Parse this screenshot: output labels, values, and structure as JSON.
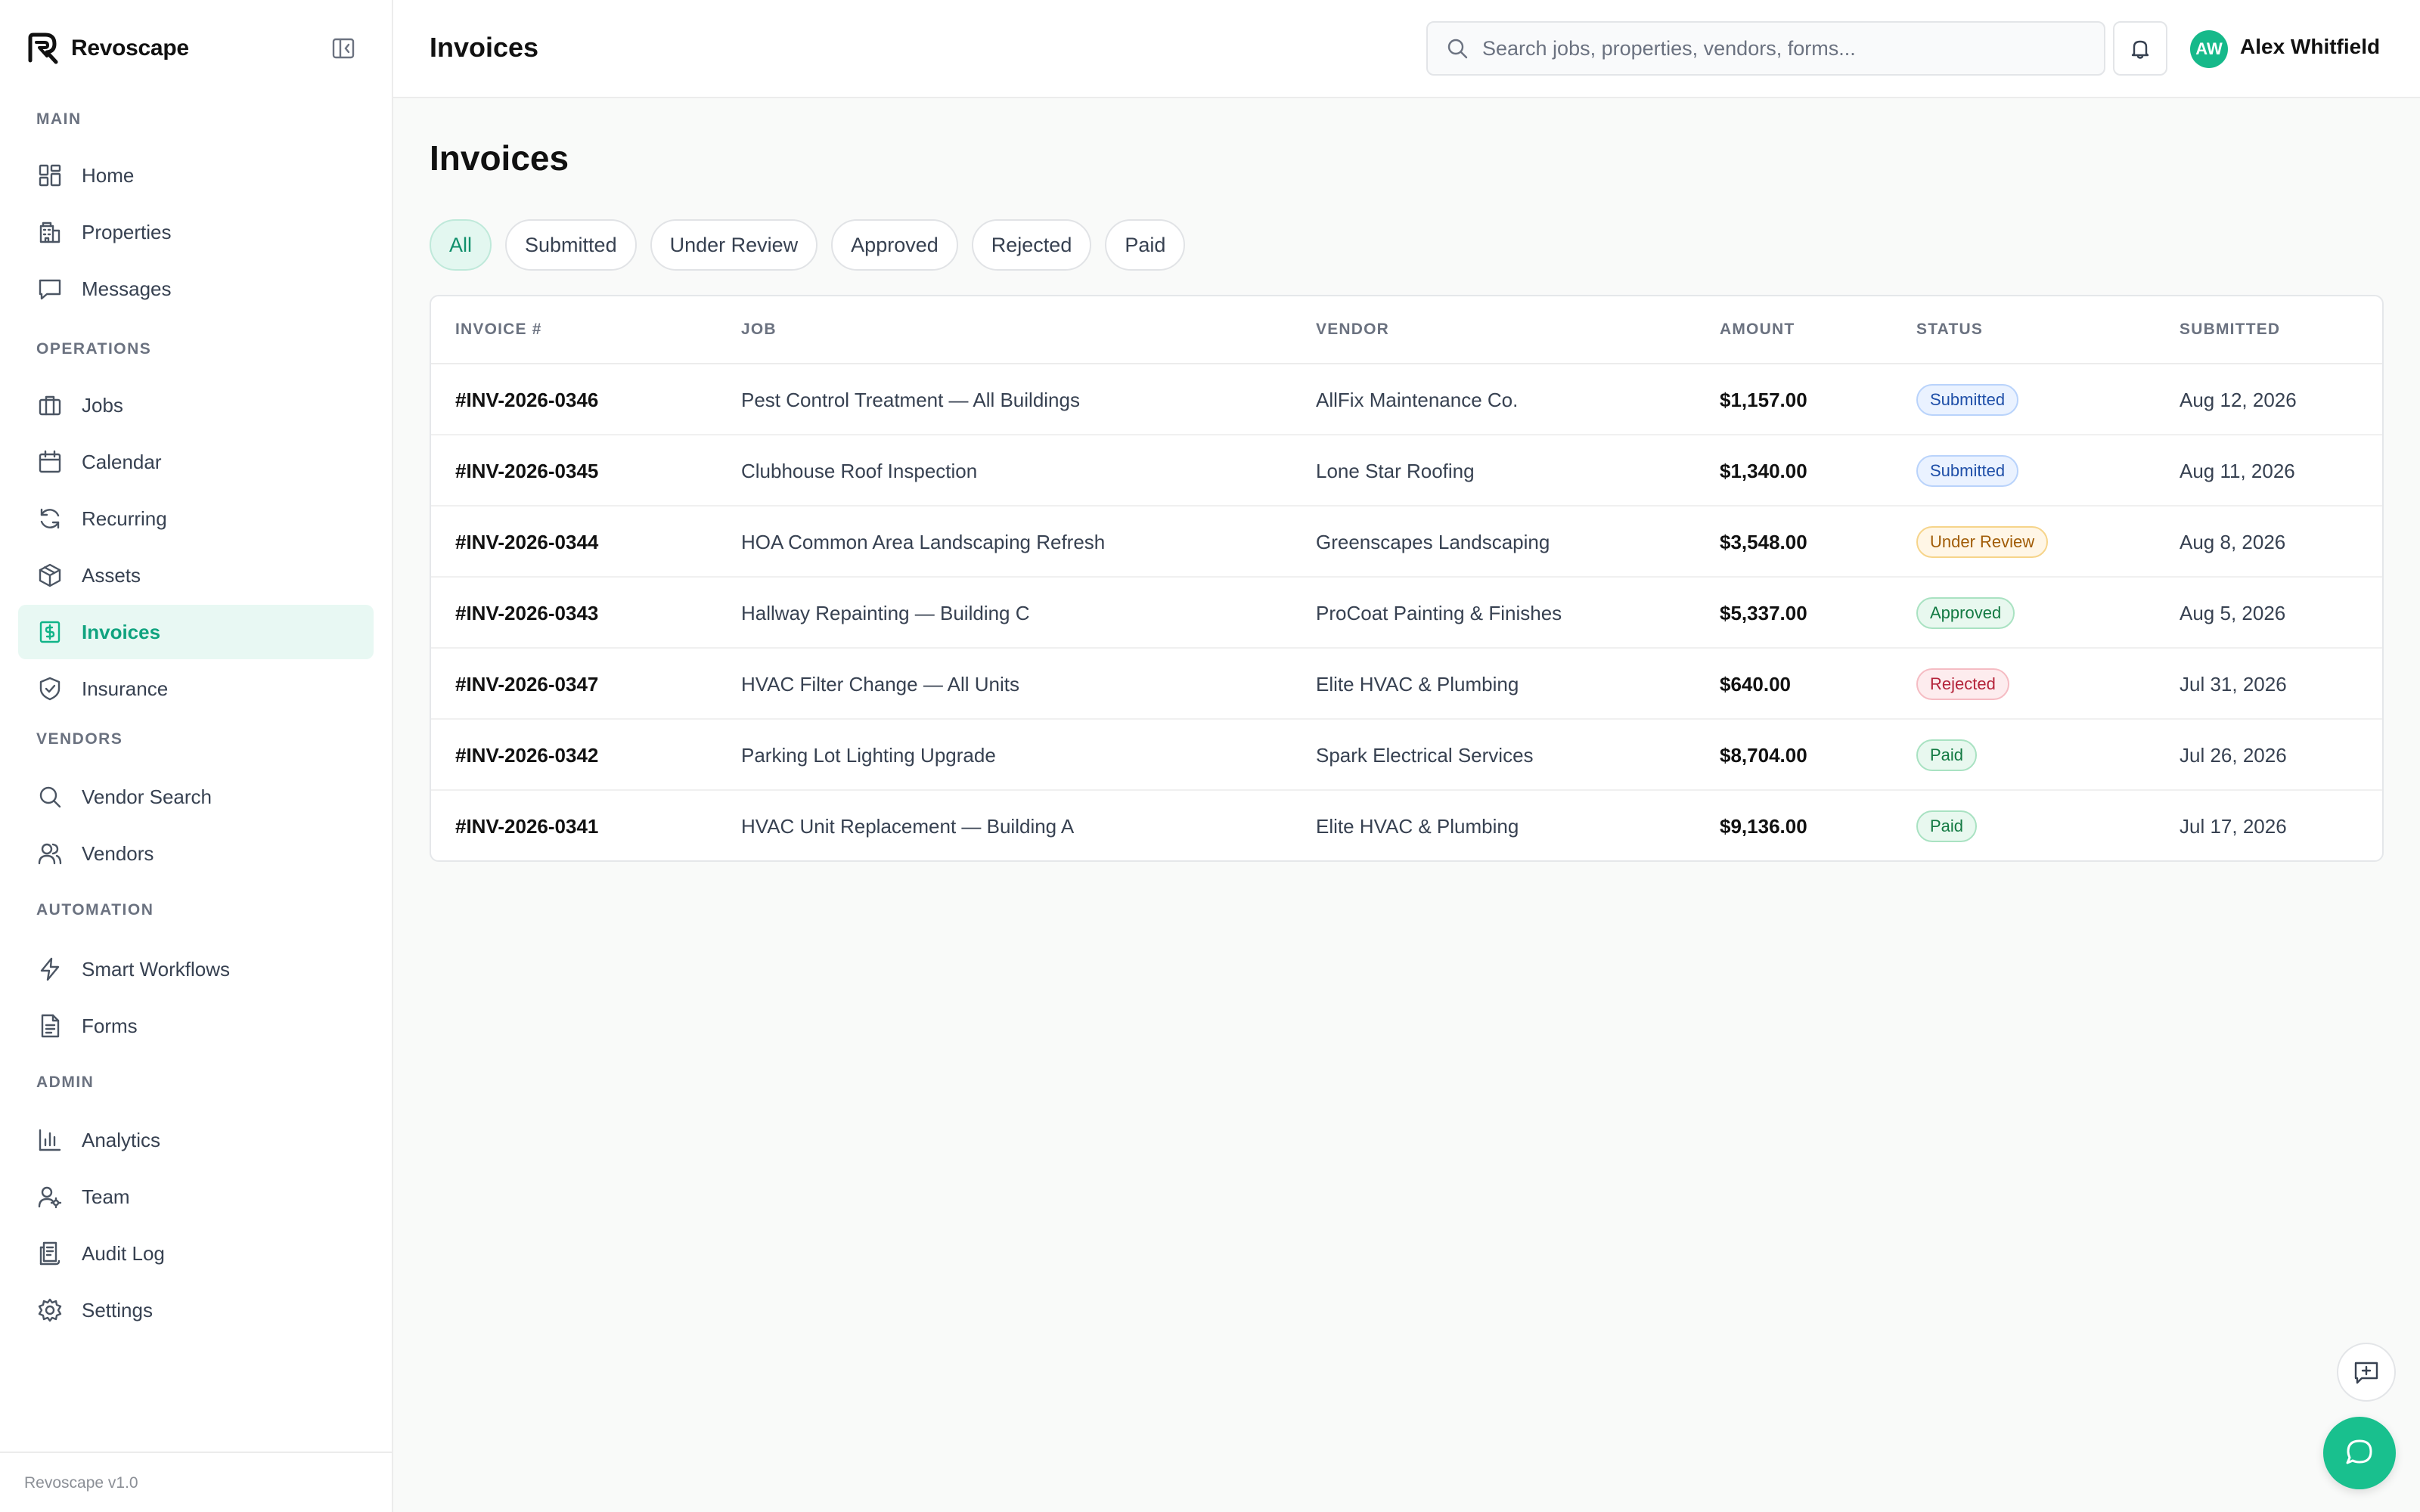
{
  "brand": {
    "name": "Revoscape",
    "version": "Revoscape v1.0"
  },
  "sidebar": {
    "sections": [
      {
        "title": "MAIN",
        "items": [
          {
            "label": "Home",
            "icon": "dashboard-icon"
          },
          {
            "label": "Properties",
            "icon": "building-icon"
          },
          {
            "label": "Messages",
            "icon": "message-icon"
          }
        ]
      },
      {
        "title": "OPERATIONS",
        "items": [
          {
            "label": "Jobs",
            "icon": "briefcase-icon"
          },
          {
            "label": "Calendar",
            "icon": "calendar-icon"
          },
          {
            "label": "Recurring",
            "icon": "refresh-icon"
          },
          {
            "label": "Assets",
            "icon": "box-icon"
          },
          {
            "label": "Invoices",
            "icon": "invoice-icon",
            "active": true
          },
          {
            "label": "Insurance",
            "icon": "shield-icon"
          }
        ]
      },
      {
        "title": "VENDORS",
        "items": [
          {
            "label": "Vendor Search",
            "icon": "search-icon"
          },
          {
            "label": "Vendors",
            "icon": "users-icon"
          }
        ]
      },
      {
        "title": "AUTOMATION",
        "items": [
          {
            "label": "Smart Workflows",
            "icon": "lightning-icon"
          },
          {
            "label": "Forms",
            "icon": "form-icon"
          }
        ]
      },
      {
        "title": "ADMIN",
        "items": [
          {
            "label": "Analytics",
            "icon": "bar-chart-icon"
          },
          {
            "label": "Team",
            "icon": "team-icon"
          },
          {
            "label": "Audit Log",
            "icon": "audit-log-icon"
          },
          {
            "label": "Settings",
            "icon": "gear-icon"
          }
        ]
      }
    ]
  },
  "header": {
    "title": "Invoices",
    "search_placeholder": "Search jobs, properties, vendors, forms...",
    "user": {
      "initials": "AW",
      "name": "Alex Whitfield"
    }
  },
  "main": {
    "title": "Invoices",
    "tabs": [
      "All",
      "Submitted",
      "Under Review",
      "Approved",
      "Rejected",
      "Paid"
    ],
    "active_tab": "All",
    "table": {
      "columns": [
        "INVOICE #",
        "JOB",
        "VENDOR",
        "AMOUNT",
        "STATUS",
        "SUBMITTED"
      ],
      "rows": [
        {
          "invoice": "#INV-2026-0346",
          "job": "Pest Control Treatment — All Buildings",
          "vendor": "AllFix Maintenance Co.",
          "amount": "$1,157.00",
          "status": "Submitted",
          "submitted": "Aug 12, 2026"
        },
        {
          "invoice": "#INV-2026-0345",
          "job": "Clubhouse Roof Inspection",
          "vendor": "Lone Star Roofing",
          "amount": "$1,340.00",
          "status": "Submitted",
          "submitted": "Aug 11, 2026"
        },
        {
          "invoice": "#INV-2026-0344",
          "job": "HOA Common Area Landscaping Refresh",
          "vendor": "Greenscapes Landscaping",
          "amount": "$3,548.00",
          "status": "Under Review",
          "submitted": "Aug 8, 2026"
        },
        {
          "invoice": "#INV-2026-0343",
          "job": "Hallway Repainting — Building C",
          "vendor": "ProCoat Painting & Finishes",
          "amount": "$5,337.00",
          "status": "Approved",
          "submitted": "Aug 5, 2026"
        },
        {
          "invoice": "#INV-2026-0347",
          "job": "HVAC Filter Change — All Units",
          "vendor": "Elite HVAC & Plumbing",
          "amount": "$640.00",
          "status": "Rejected",
          "submitted": "Jul 31, 2026"
        },
        {
          "invoice": "#INV-2026-0342",
          "job": "Parking Lot Lighting Upgrade",
          "vendor": "Spark Electrical Services",
          "amount": "$8,704.00",
          "status": "Paid",
          "submitted": "Jul 26, 2026"
        },
        {
          "invoice": "#INV-2026-0341",
          "job": "HVAC Unit Replacement — Building A",
          "vendor": "Elite HVAC & Plumbing",
          "amount": "$9,136.00",
          "status": "Paid",
          "submitted": "Jul 17, 2026"
        }
      ]
    },
    "status_colors": {
      "Submitted": {
        "bg": "#eaf2ff",
        "border": "#b9d3fb",
        "fg": "#1f4fa8"
      },
      "Under Review": {
        "bg": "#fff6e6",
        "border": "#f6d48a",
        "fg": "#a15c07"
      },
      "Approved": {
        "bg": "#e8f8ef",
        "border": "#a9e2c2",
        "fg": "#137a43"
      },
      "Rejected": {
        "bg": "#fdecee",
        "border": "#f5bcc3",
        "fg": "#b4233a"
      },
      "Paid": {
        "bg": "#e8f8ef",
        "border": "#a9e2c2",
        "fg": "#137a43"
      }
    }
  },
  "colors": {
    "accent": "#10b488",
    "accent_bg": "#e8f8f3"
  }
}
